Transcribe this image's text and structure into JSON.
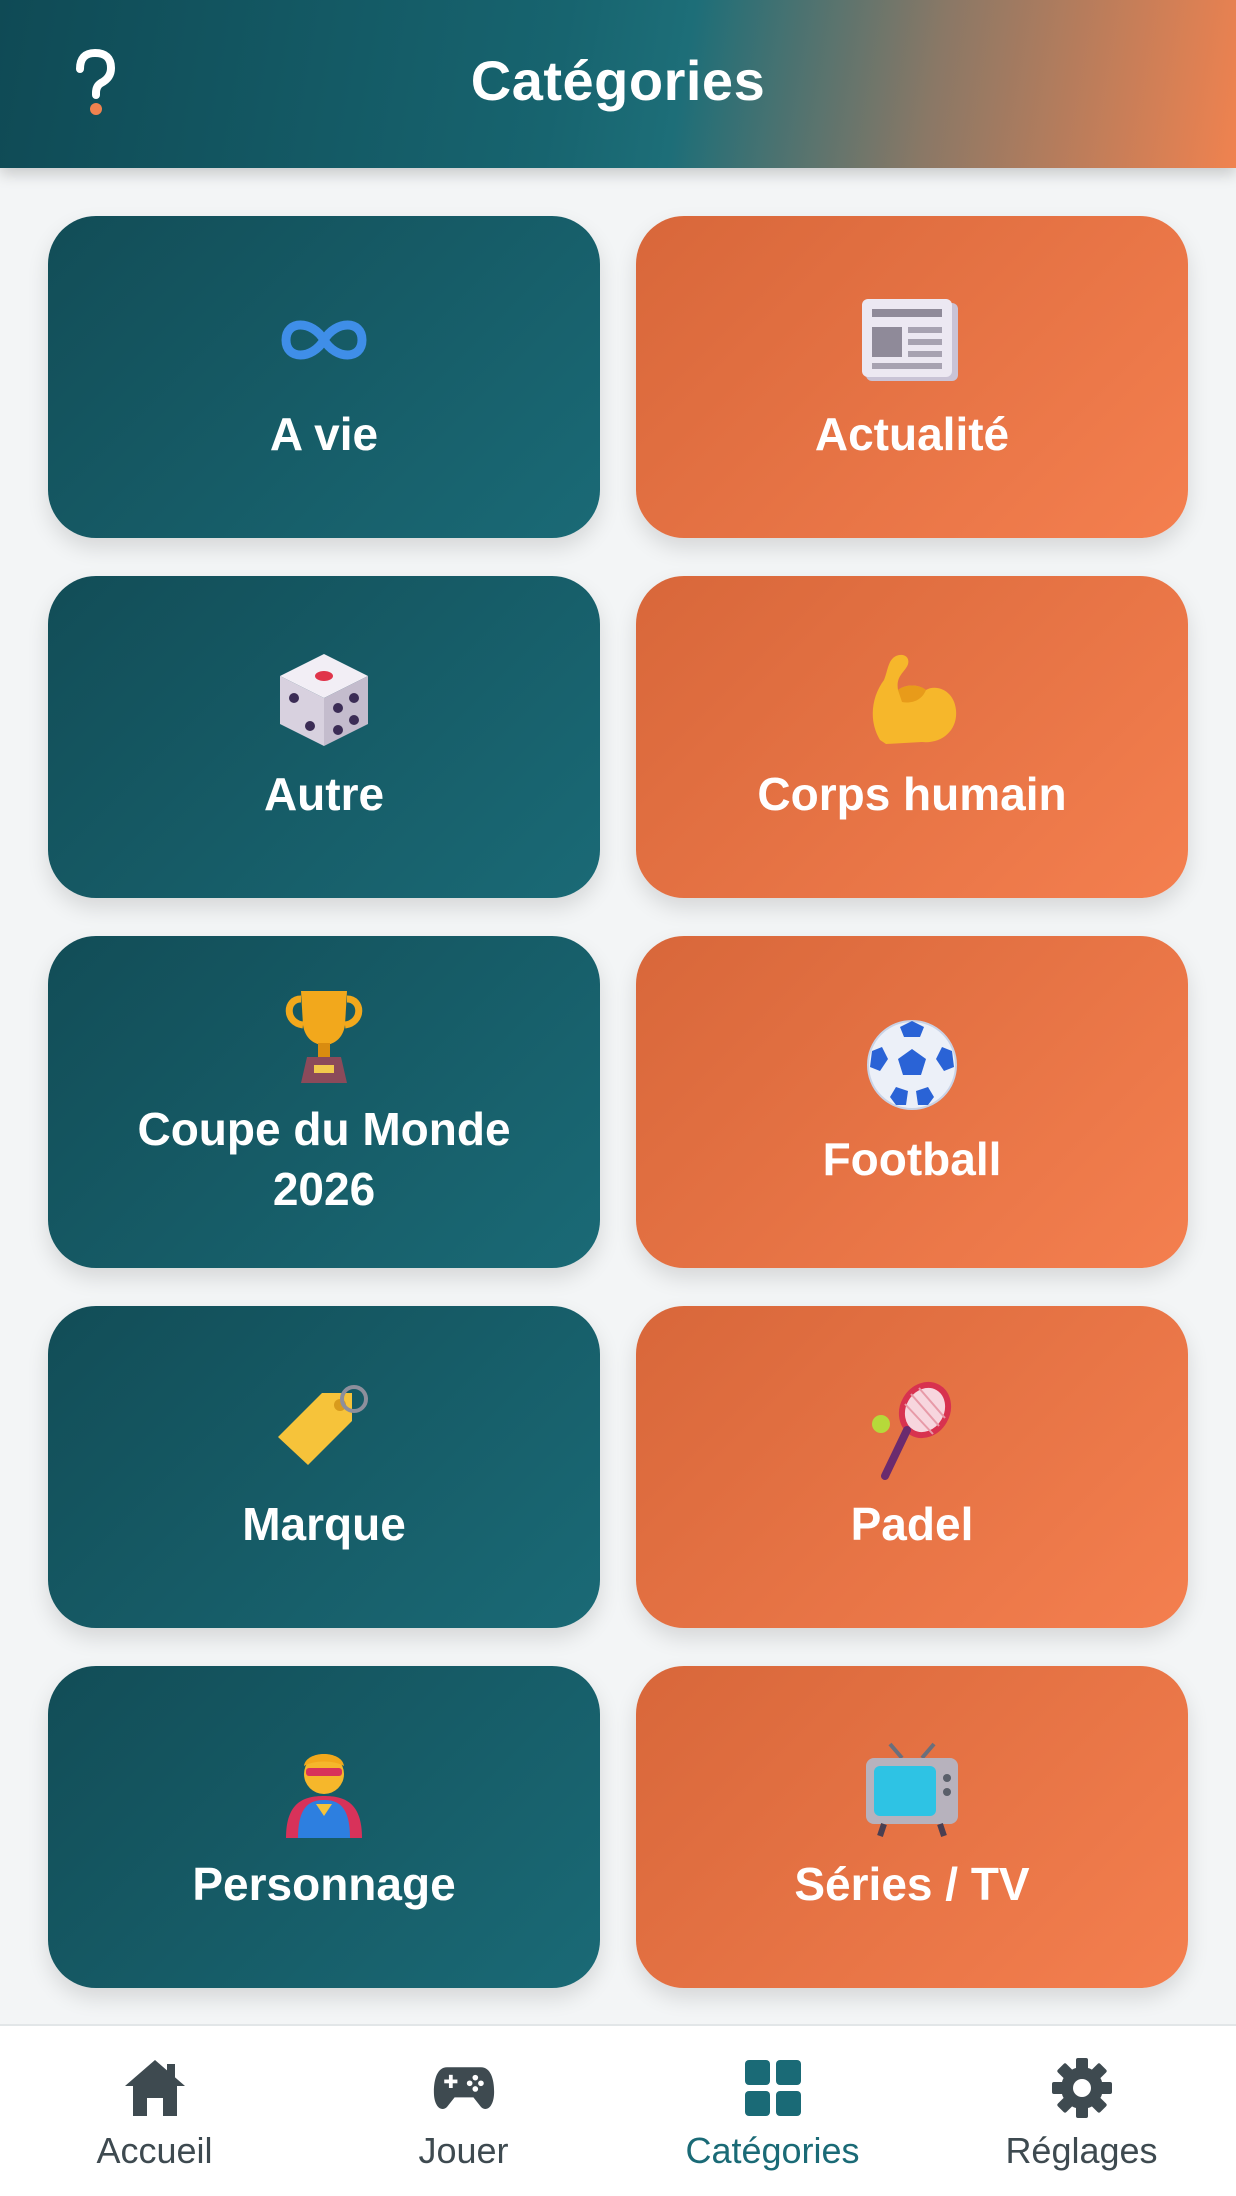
{
  "header": {
    "title": "Catégories",
    "help_label": "?"
  },
  "categories": [
    {
      "label": "A vie",
      "icon": "infinity-icon",
      "theme": "teal"
    },
    {
      "label": "Actualité",
      "icon": "newspaper-icon",
      "theme": "orange"
    },
    {
      "label": "Autre",
      "icon": "dice-icon",
      "theme": "teal"
    },
    {
      "label": "Corps humain",
      "icon": "flexed-biceps-icon",
      "theme": "orange"
    },
    {
      "label": "Coupe du Monde 2026",
      "icon": "trophy-icon",
      "theme": "teal"
    },
    {
      "label": "Football",
      "icon": "soccer-ball-icon",
      "theme": "orange"
    },
    {
      "label": "Marque",
      "icon": "label-tag-icon",
      "theme": "teal"
    },
    {
      "label": "Padel",
      "icon": "tennis-racket-icon",
      "theme": "orange"
    },
    {
      "label": "Personnage",
      "icon": "superhero-icon",
      "theme": "teal"
    },
    {
      "label": "Séries / TV",
      "icon": "television-icon",
      "theme": "orange"
    }
  ],
  "nav": {
    "items": [
      {
        "label": "Accueil",
        "icon": "home-icon",
        "active": false
      },
      {
        "label": "Jouer",
        "icon": "gamepad-icon",
        "active": false
      },
      {
        "label": "Catégories",
        "icon": "grid-icon",
        "active": true
      },
      {
        "label": "Réglages",
        "icon": "gear-icon",
        "active": false
      }
    ]
  },
  "colors": {
    "teal": "#1a6a76",
    "orange": "#f07c4c",
    "accent_dot": "#f0824f"
  }
}
